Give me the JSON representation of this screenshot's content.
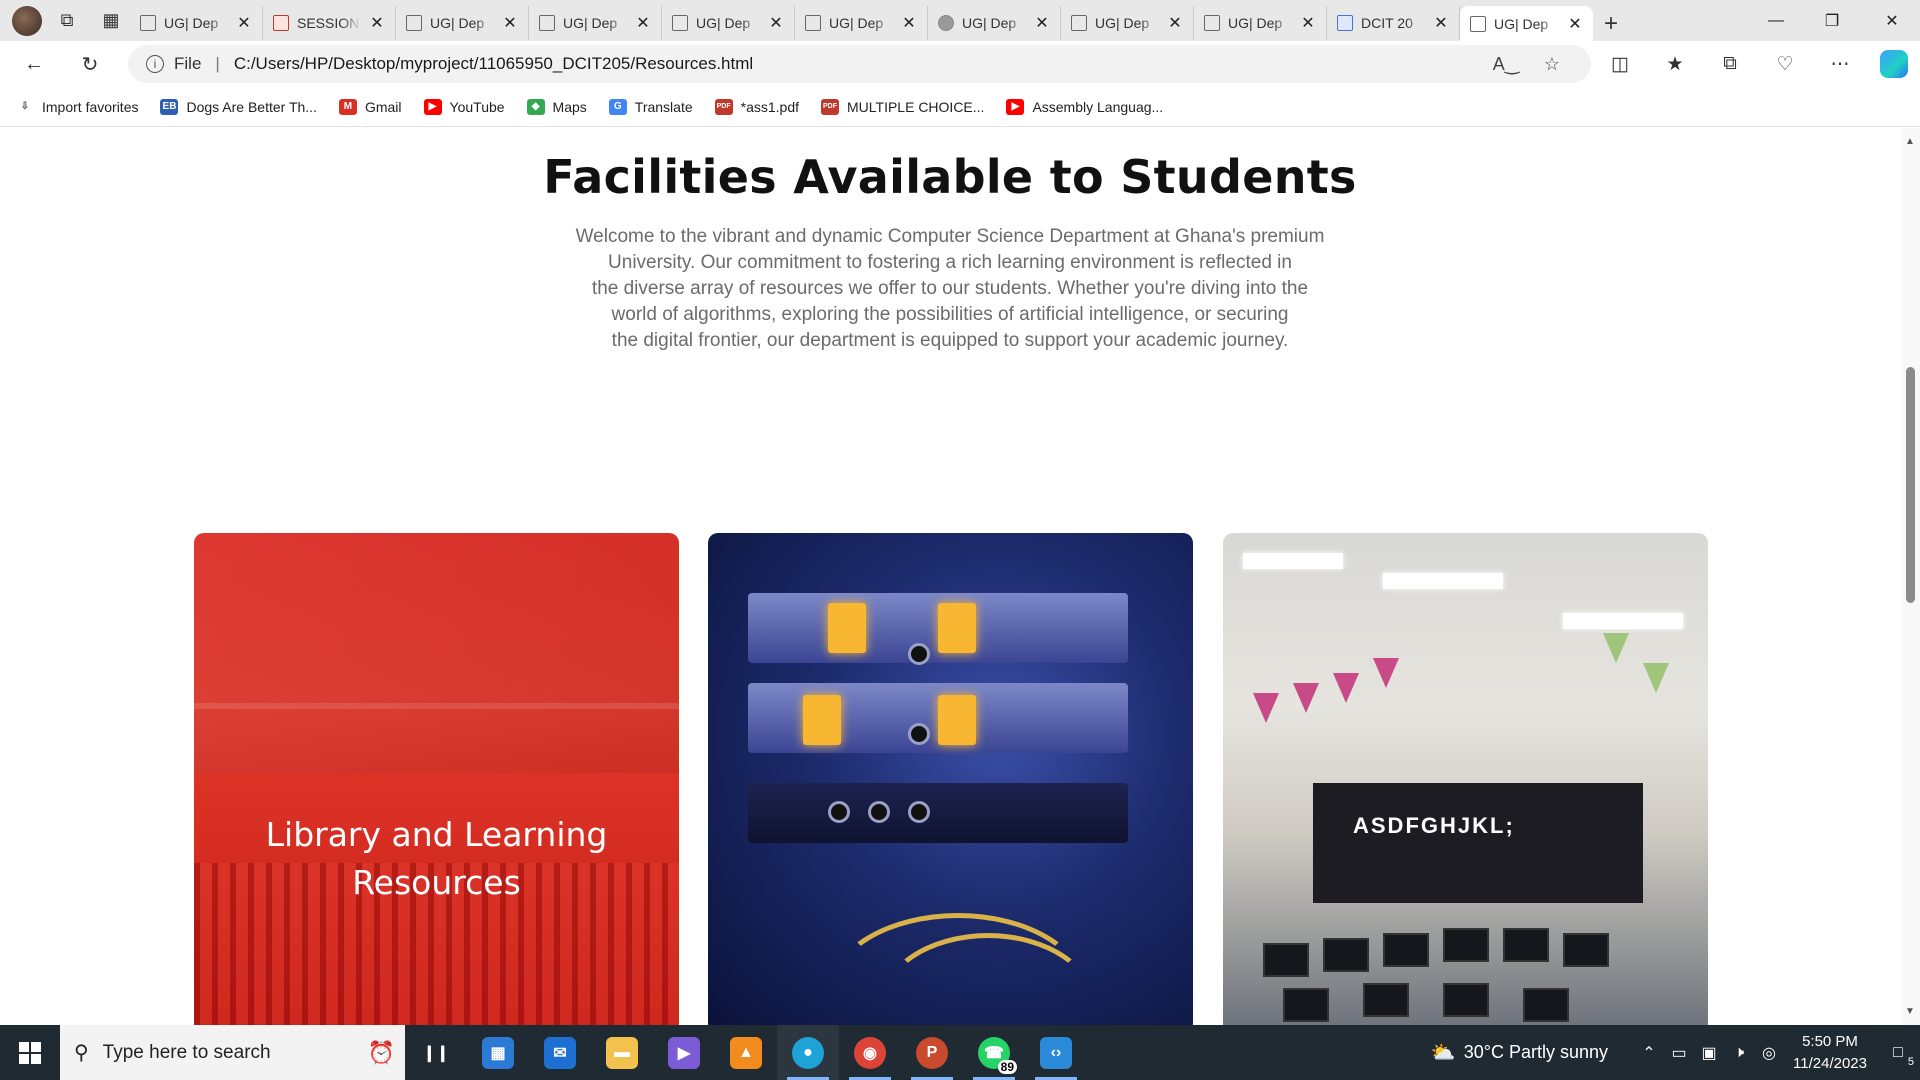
{
  "browser": {
    "tabs": [
      {
        "title": "UG| Dep",
        "icon": "page-icon",
        "active": false
      },
      {
        "title": "SESSION",
        "icon": "pdf-icon",
        "active": false
      },
      {
        "title": "UG| Dep",
        "icon": "page-icon",
        "active": false
      },
      {
        "title": "UG| Dep",
        "icon": "page-icon",
        "active": false
      },
      {
        "title": "UG| Dep",
        "icon": "page-icon",
        "active": false
      },
      {
        "title": "UG| Dep",
        "icon": "page-icon",
        "active": false
      },
      {
        "title": "UG| Dep",
        "icon": "globe-icon",
        "active": false
      },
      {
        "title": "UG| Dep",
        "icon": "page-icon",
        "active": false
      },
      {
        "title": "UG| Dep",
        "icon": "page-icon",
        "active": false
      },
      {
        "title": "DCIT 20",
        "icon": "doc-icon",
        "active": false
      },
      {
        "title": "UG| Dep",
        "icon": "page-icon",
        "active": true
      }
    ],
    "address": {
      "scheme_label": "File",
      "url": "C:/Users/HP/Desktop/myproject/11065950_DCIT205/Resources.html"
    },
    "favorites": [
      {
        "label": "Import favorites",
        "icon": "import-icon",
        "color": "#555555"
      },
      {
        "label": "Dogs Are Better Th...",
        "icon": "eb-icon",
        "color": "#2d5fb3"
      },
      {
        "label": "Gmail",
        "icon": "gmail-icon",
        "color": "#d93025"
      },
      {
        "label": "YouTube",
        "icon": "youtube-icon",
        "color": "#ff0000"
      },
      {
        "label": "Maps",
        "icon": "maps-icon",
        "color": "#34a853"
      },
      {
        "label": "Translate",
        "icon": "translate-icon",
        "color": "#4285f4"
      },
      {
        "label": "*ass1.pdf",
        "icon": "pdf-icon",
        "color": "#c0392b"
      },
      {
        "label": "MULTIPLE CHOICE...",
        "icon": "pdf-icon",
        "color": "#c0392b"
      },
      {
        "label": "Assembly Languag...",
        "icon": "youtube-icon",
        "color": "#ff0000"
      }
    ]
  },
  "page": {
    "title": "Facilities Available to Students",
    "intro_lines": [
      "Welcome to the vibrant and dynamic Computer Science Department at Ghana's premium",
      "University. Our commitment to fostering a rich learning environment is reflected in",
      "the diverse array of resources we offer to our students. Whether you're diving into the",
      "world of algorithms, exploring the possibilities of artificial intelligence, or securing",
      "the digital frontier, our department is equipped to support your academic journey."
    ],
    "cards": [
      {
        "caption": "Library and Learning Resources",
        "accent": "#d9271f"
      },
      {
        "caption": "",
        "accent": "#1c2a6b"
      },
      {
        "caption": "",
        "accent": "#d8d8d4"
      }
    ],
    "lab_board_text": "ASDFGHJKL;"
  },
  "taskbar": {
    "search_placeholder": "Type here to search",
    "apps": [
      {
        "name": "task-view-icon",
        "label": ""
      },
      {
        "name": "microsoft-store-icon",
        "label": ""
      },
      {
        "name": "mail-icon",
        "label": ""
      },
      {
        "name": "file-explorer-icon",
        "label": ""
      },
      {
        "name": "clipchamp-icon",
        "label": ""
      },
      {
        "name": "vlc-icon",
        "label": ""
      },
      {
        "name": "edge-icon",
        "label": ""
      },
      {
        "name": "chrome-icon",
        "label": ""
      },
      {
        "name": "powerpoint-icon",
        "label": "P"
      },
      {
        "name": "whatsapp-icon",
        "label": ""
      },
      {
        "name": "vscode-icon",
        "label": ""
      }
    ],
    "whatsapp_badge": "89",
    "weather": "30°C  Partly sunny",
    "time": "5:50 PM",
    "date": "11/24/2023",
    "notifications": "5"
  }
}
